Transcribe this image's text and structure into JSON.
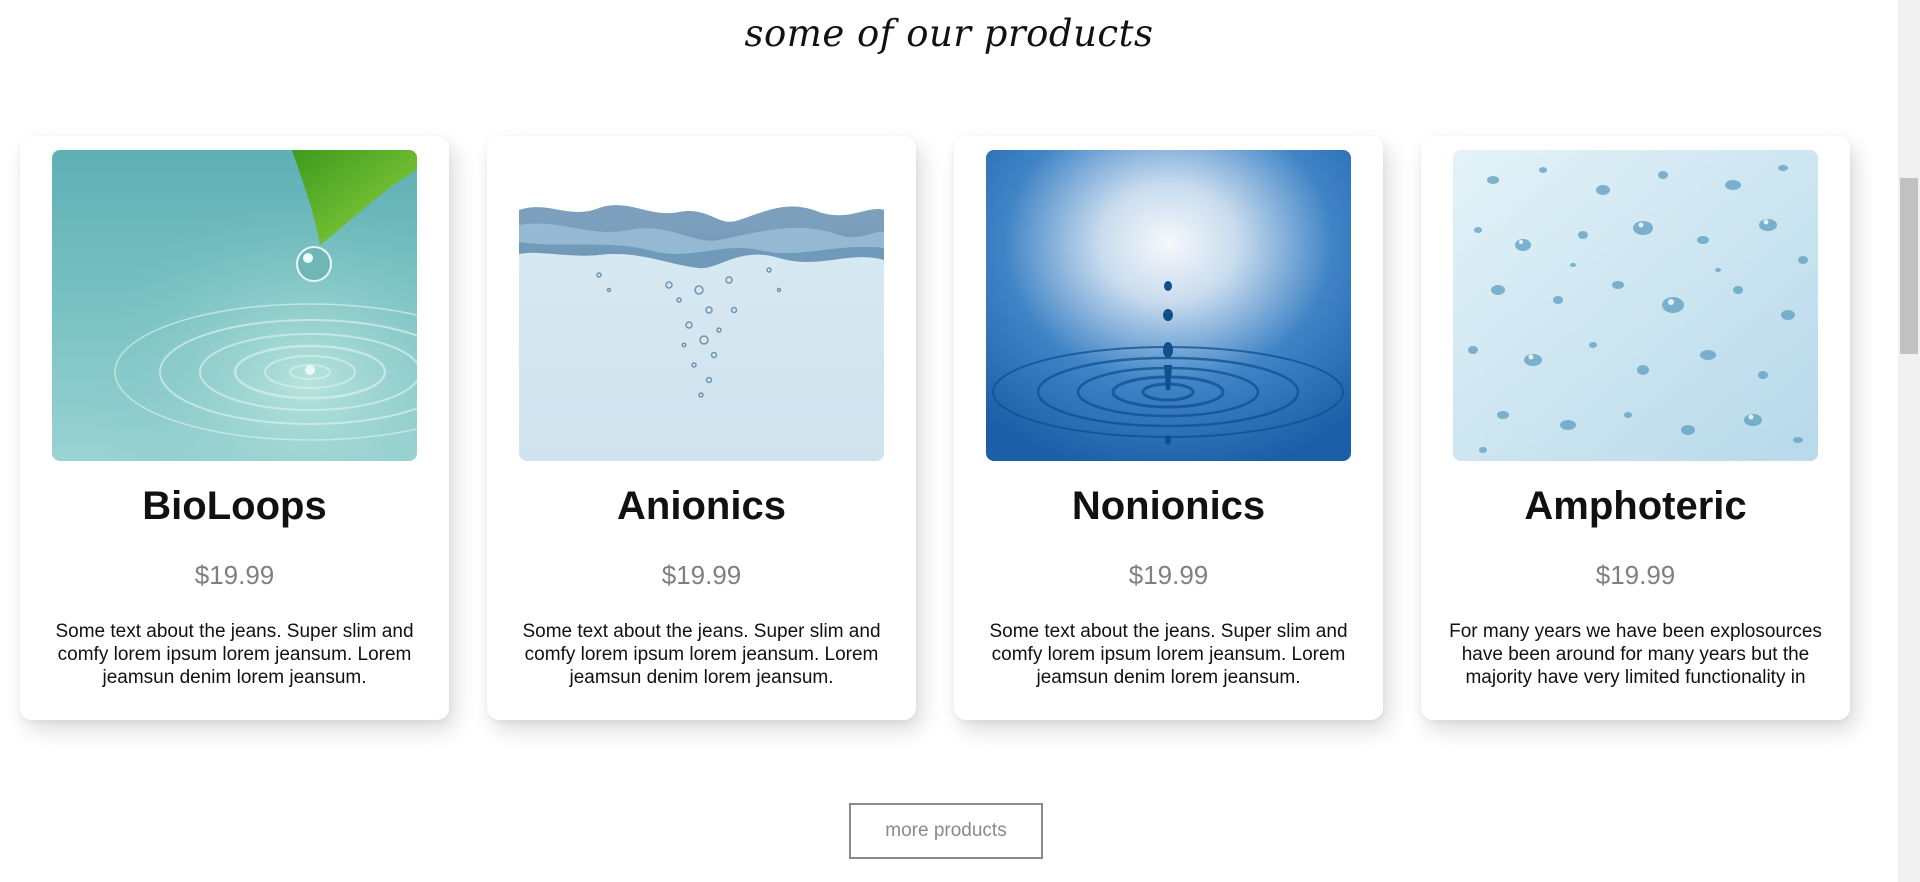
{
  "section": {
    "title": "some of our products"
  },
  "products": [
    {
      "name": "BioLoops",
      "price": "$19.99",
      "description": "Some text about the jeans. Super slim and comfy lorem ipsum lorem jeansum. Lorem jeamsun denim lorem jeansum.",
      "image_icon": "water-drop-leaf-image"
    },
    {
      "name": "Anionics",
      "price": "$19.99",
      "description": "Some text about the jeans. Super slim and comfy lorem ipsum lorem jeansum. Lorem jeamsun denim lorem jeansum.",
      "image_icon": "water-surface-bubbles-image"
    },
    {
      "name": "Nonionics",
      "price": "$19.99",
      "description": "Some text about the jeans. Super slim and comfy lorem ipsum lorem jeansum. Lorem jeamsun denim lorem jeansum.",
      "image_icon": "water-droplet-ripple-image"
    },
    {
      "name": "Amphoteric",
      "price": "$19.99",
      "description": "For many years we have been explosources have been around for many years but the majority have very limited functionality in",
      "image_icon": "water-droplets-glass-image"
    }
  ],
  "more_button": {
    "label": "more products"
  },
  "colors": {
    "price": "#808080",
    "button_border": "#8a8a8a"
  }
}
